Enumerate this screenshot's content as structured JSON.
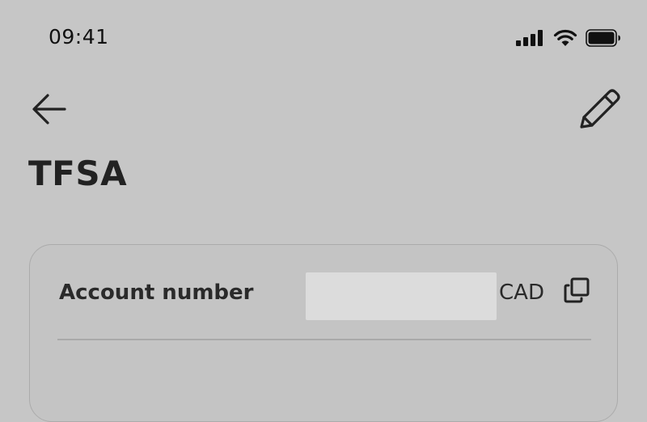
{
  "status_bar": {
    "time": "09:41",
    "icons": [
      "cellular-signal-icon",
      "wifi-icon",
      "battery-icon"
    ]
  },
  "header": {
    "back_icon": "arrow-left-icon",
    "edit_icon": "pencil-icon",
    "title": "TFSA"
  },
  "account_card": {
    "account_number_label": "Account number",
    "account_number_value": "",
    "currency": "CAD",
    "copy_icon": "copy-icon"
  },
  "colors": {
    "background": "#c6c6c6",
    "text": "#1c1c1c",
    "card_border": "#ababab",
    "masked_value": "#dcdcdc"
  }
}
